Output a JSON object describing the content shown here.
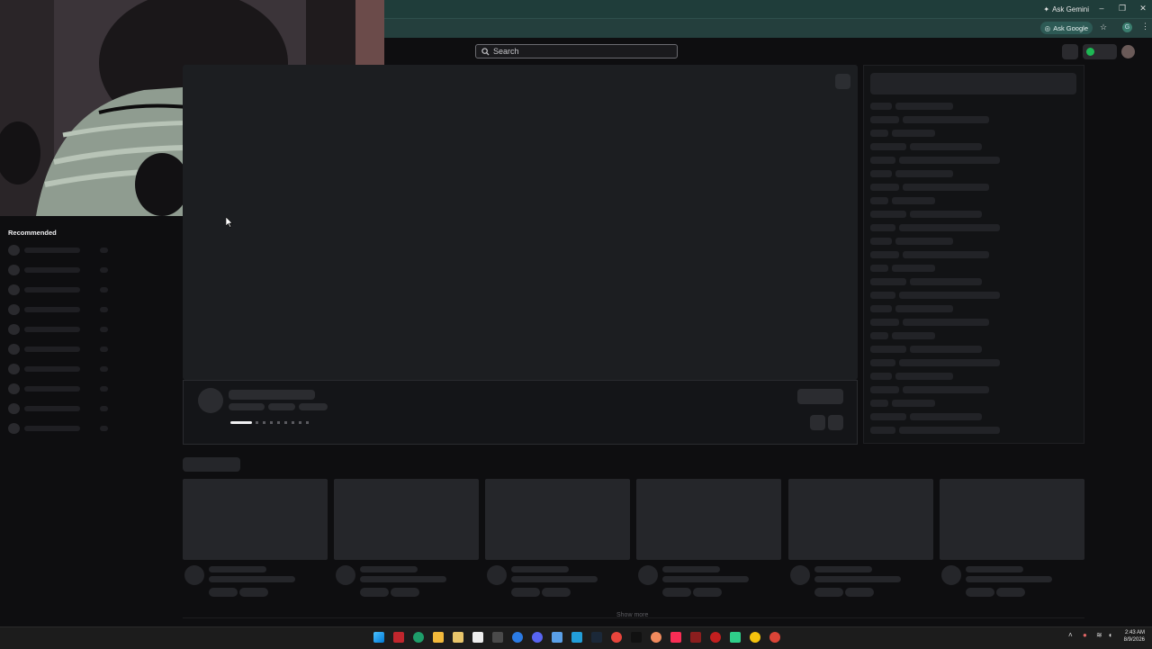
{
  "browser": {
    "ask_gemini": "Ask Gemini",
    "ask_google": "Ask Google",
    "profile_letter": "G"
  },
  "search": {
    "placeholder": "Search"
  },
  "sidebar": {
    "title": "Recommended"
  },
  "main": {
    "show_more": "Show more"
  },
  "taskbar": {
    "time": "2:43 AM",
    "date": "8/9/2026"
  },
  "colors": {
    "chrome_top": "#1f3d3a",
    "skeleton": "#2a2a2e",
    "background": "#0e0e10"
  }
}
